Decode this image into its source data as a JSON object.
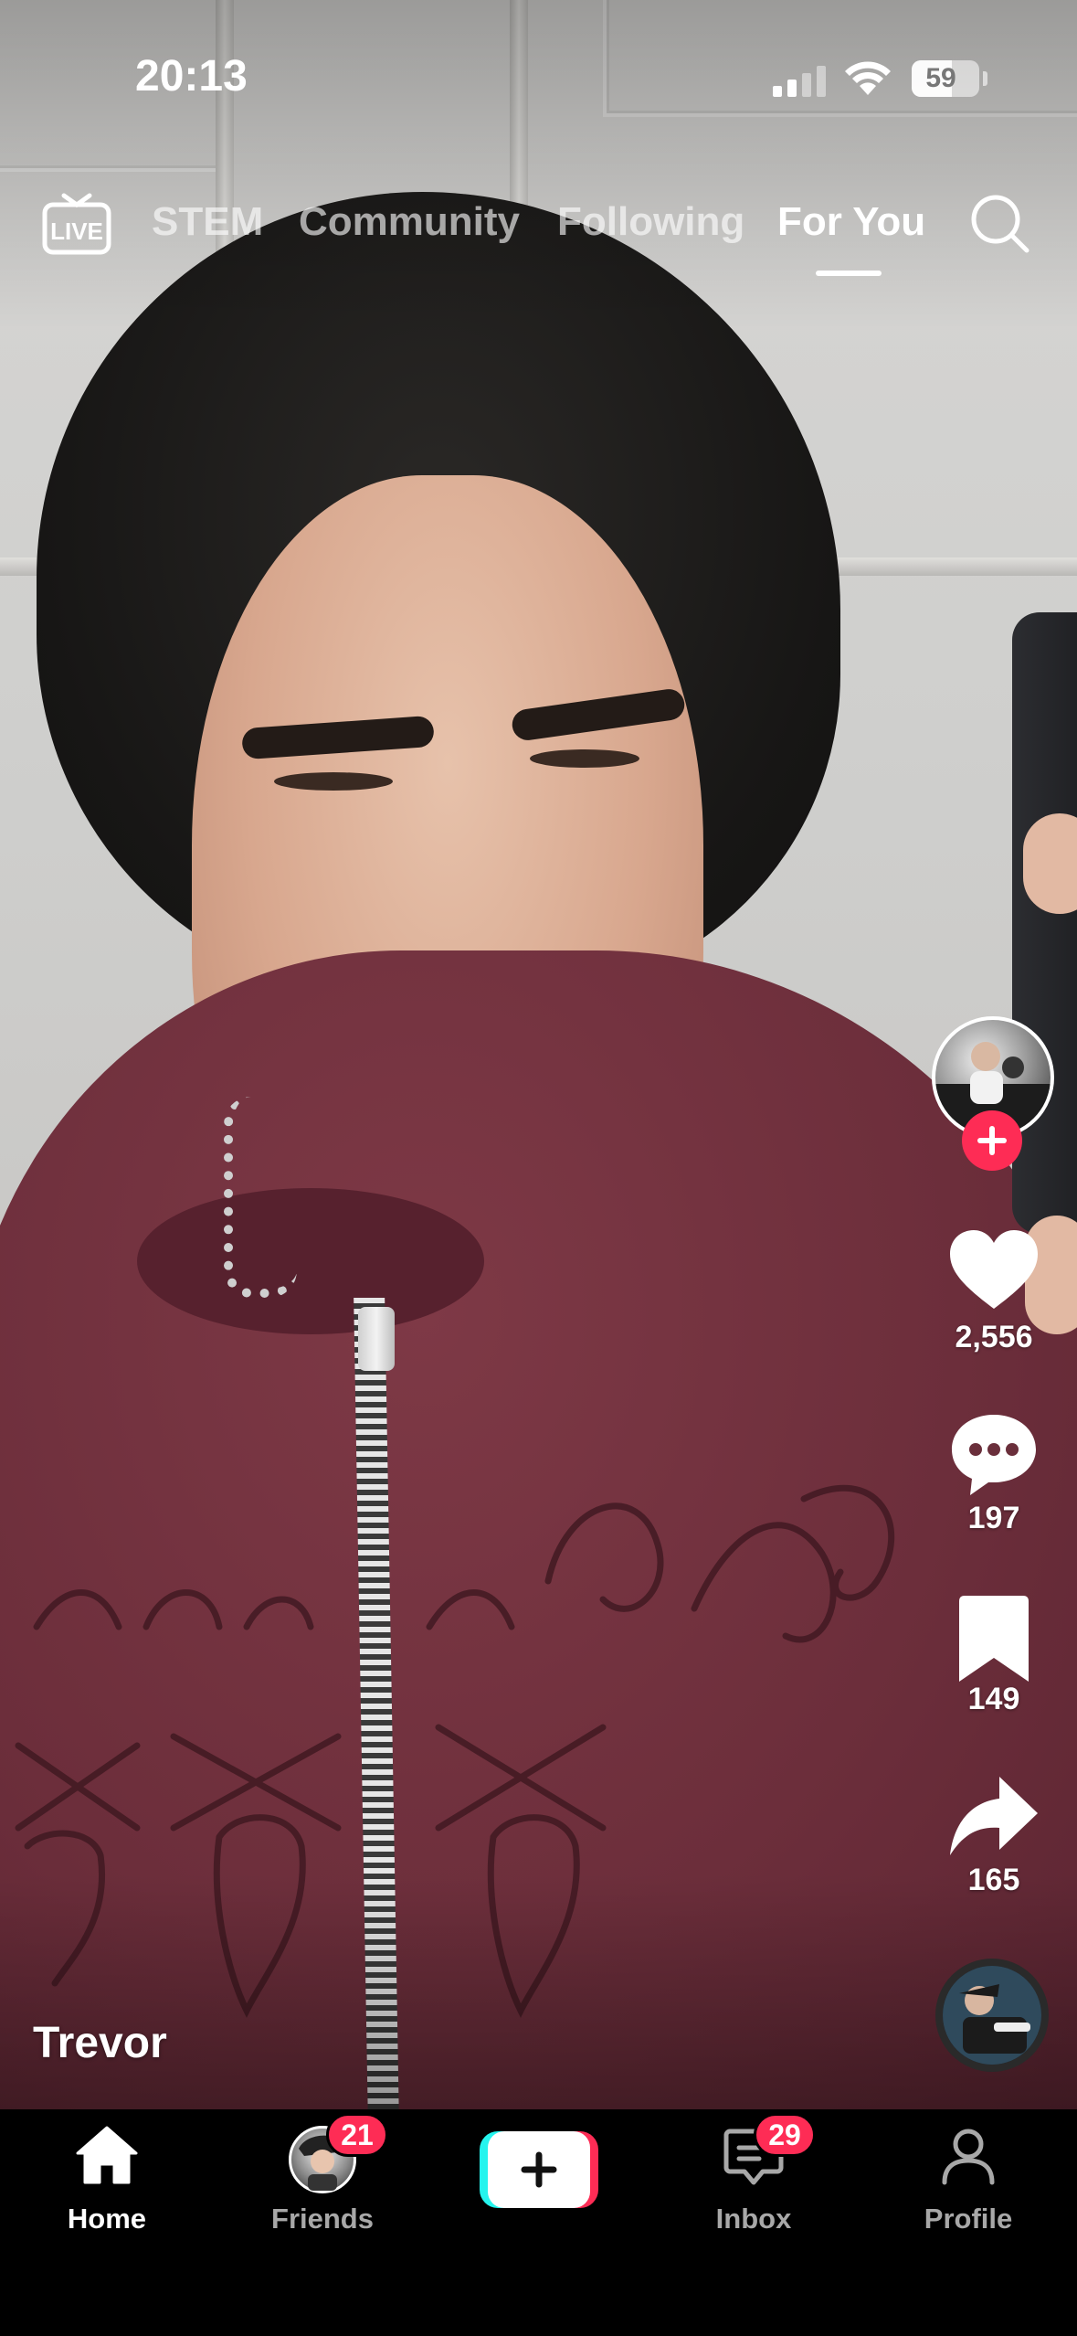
{
  "status_bar": {
    "time": "20:13",
    "battery": "59",
    "battery_percent": 59
  },
  "top_nav": {
    "live_icon": "live-tv-icon",
    "tabs": [
      {
        "label": "STEM"
      },
      {
        "label": "Community"
      },
      {
        "label": "Following"
      },
      {
        "label": "For You",
        "active": true
      }
    ],
    "search_icon": "search-icon"
  },
  "video": {
    "username": "Trevor"
  },
  "actions": {
    "likes": "2,556",
    "comments": "197",
    "saves": "149",
    "shares": "165"
  },
  "bottom_nav": {
    "items": [
      {
        "label": "Home",
        "icon": "home-icon",
        "active": true
      },
      {
        "label": "Friends",
        "badge": "21"
      },
      {
        "label": "",
        "icon": "plus-icon"
      },
      {
        "label": "Inbox",
        "icon": "inbox-icon",
        "badge": "29"
      },
      {
        "label": "Profile",
        "icon": "profile-icon"
      }
    ]
  },
  "colors": {
    "accent": "#fe2c55",
    "cyan": "#25f4ee",
    "tab_bar": "#000000"
  }
}
